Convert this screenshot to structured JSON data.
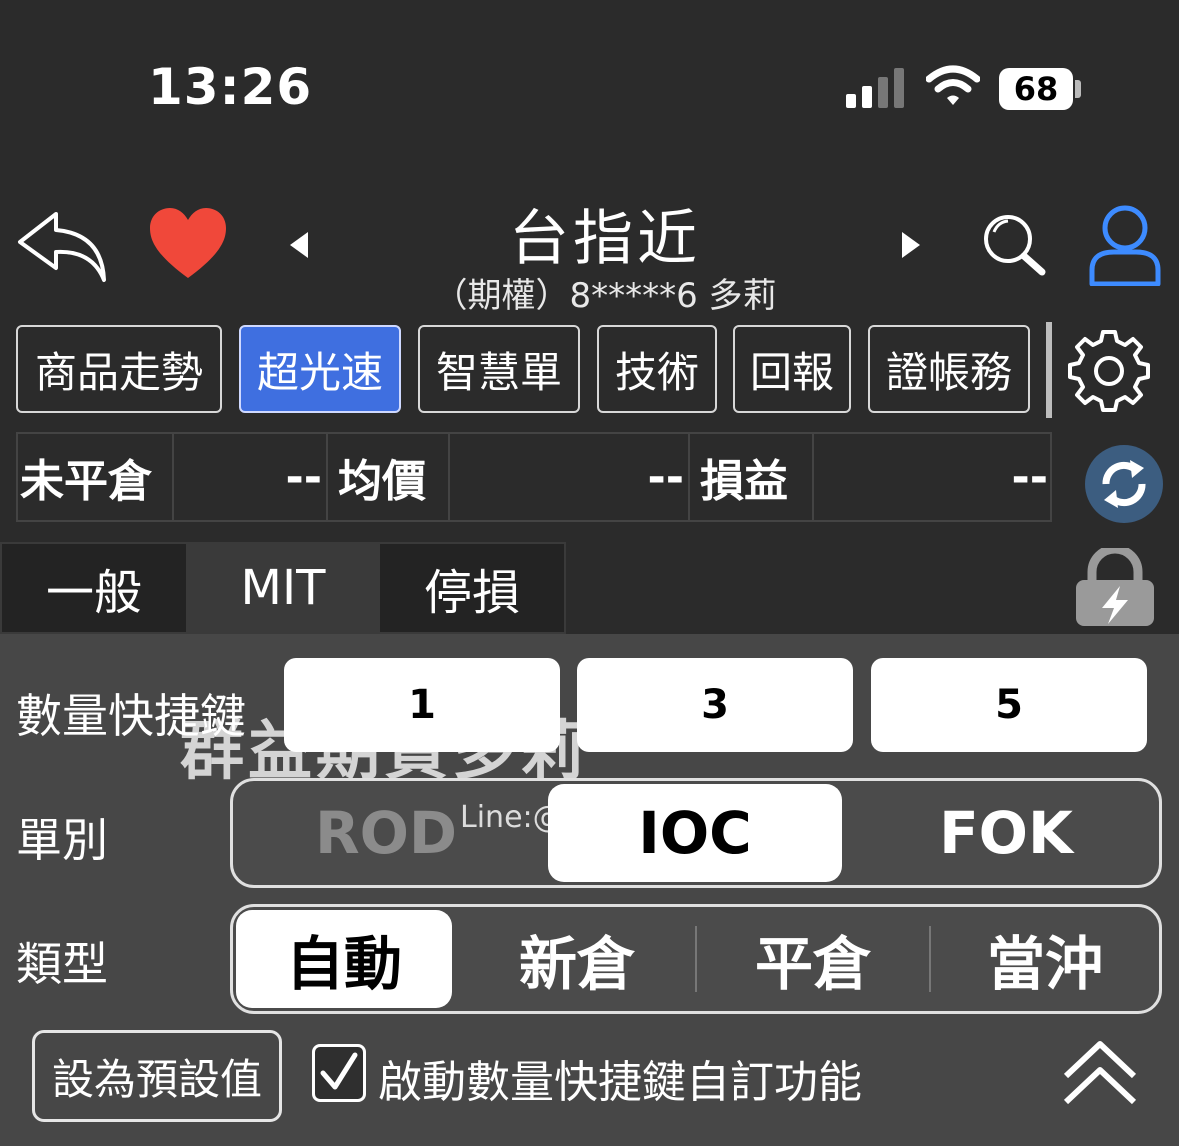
{
  "status_bar": {
    "time": "13:26",
    "battery": "68"
  },
  "header": {
    "title": "台指近",
    "subtitle": "（期權）8*****6 多莉"
  },
  "tabs": [
    {
      "label": "商品走勢",
      "active": false
    },
    {
      "label": "超光速",
      "active": true
    },
    {
      "label": "智慧單",
      "active": false
    },
    {
      "label": "技術",
      "active": false
    },
    {
      "label": "回報",
      "active": false
    },
    {
      "label": "證帳務",
      "active": false
    }
  ],
  "position": {
    "open_label": "未平倉",
    "open_value": "--",
    "avg_label": "均價",
    "avg_value": "--",
    "pnl_label": "損益",
    "pnl_value": "--"
  },
  "order_tabs": [
    {
      "label": "一般",
      "active": false
    },
    {
      "label": "MIT",
      "active": true
    },
    {
      "label": "停損",
      "active": false
    }
  ],
  "settings": {
    "quick_qty_label": "數量快捷鍵",
    "quick_qty": [
      "1",
      "3",
      "5"
    ],
    "order_type_label": "單別",
    "order_types": [
      "ROD",
      "IOC",
      "FOK"
    ],
    "order_type_selected": "IOC",
    "category_label": "類型",
    "categories": [
      "自動",
      "新倉",
      "平倉",
      "當沖"
    ],
    "category_selected": "自動",
    "default_button": "設為預設值",
    "custom_checkbox_label": "啟動數量快捷鍵自訂功能",
    "custom_checked": true
  },
  "watermark": {
    "text": "群益期貨多莉",
    "line": "Line:@"
  }
}
